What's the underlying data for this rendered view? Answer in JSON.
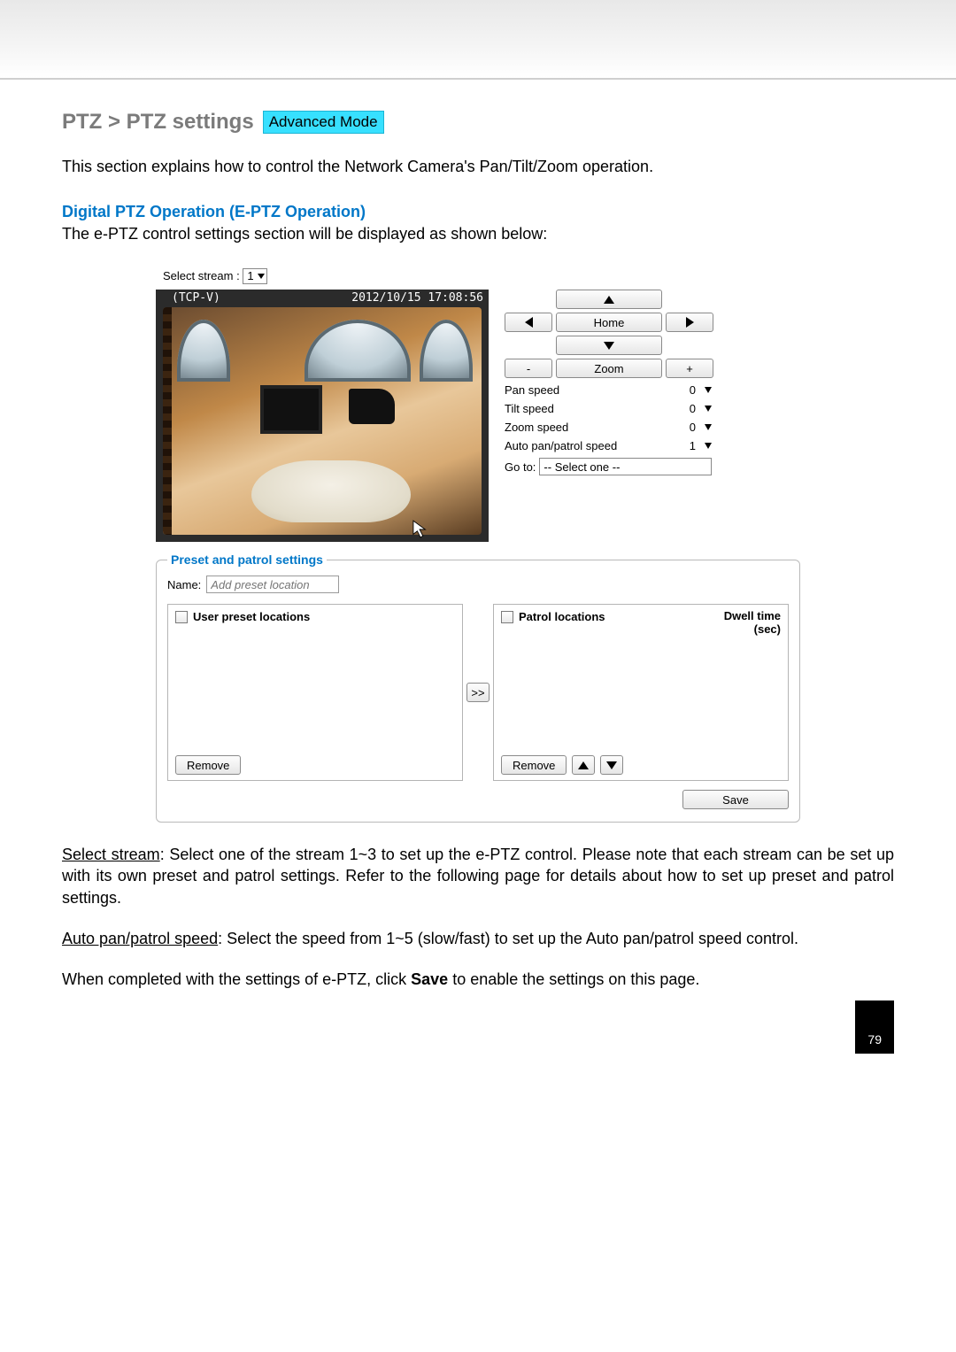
{
  "breadcrumb": "PTZ > PTZ settings",
  "badge": "Advanced Mode",
  "intro": "This section explains how to control the Network Camera's Pan/Tilt/Zoom operation.",
  "subhead": "Digital PTZ Operation (E-PTZ Operation)",
  "subdesc": "The e-PTZ control settings section will be displayed as shown below:",
  "panel": {
    "stream_label": "Select stream :",
    "stream_value": "1",
    "overlay_tl": "(TCP-V)",
    "overlay_tr": "2012/10/15 17:08:56",
    "home_label": "Home",
    "zoom_label": "Zoom",
    "zoom_minus": "-",
    "zoom_plus": "+",
    "speeds": {
      "pan": {
        "label": "Pan speed",
        "value": "0"
      },
      "tilt": {
        "label": "Tilt speed",
        "value": "0"
      },
      "zoom": {
        "label": "Zoom speed",
        "value": "0"
      },
      "auto": {
        "label": "Auto pan/patrol speed",
        "value": "1"
      }
    },
    "goto_label": "Go to:",
    "goto_value": "-- Select one --",
    "preset": {
      "legend": "Preset and patrol settings",
      "name_label": "Name:",
      "name_placeholder": "Add preset location",
      "user_col": "User preset locations",
      "patrol_col": "Patrol locations",
      "dwell_col_1": "Dwell time",
      "dwell_col_2": "(sec)",
      "move_btn": ">>",
      "remove": "Remove",
      "save": "Save"
    }
  },
  "body": {
    "p1_u": "Select stream",
    "p1_rest": ": Select one of the stream 1~3 to set up the e-PTZ control. Please note that each stream can be set up with its own preset and patrol settings. Refer to the following page for details about how to set up preset and patrol settings.",
    "p2_u": "Auto pan/patrol speed",
    "p2_rest": ": Select the speed from 1~5 (slow/fast) to set up the Auto pan/patrol speed control.",
    "p3_a": "When completed with the settings of e-PTZ, click ",
    "p3_b": "Save",
    "p3_c": " to enable the settings on this page."
  },
  "page_number": "79"
}
